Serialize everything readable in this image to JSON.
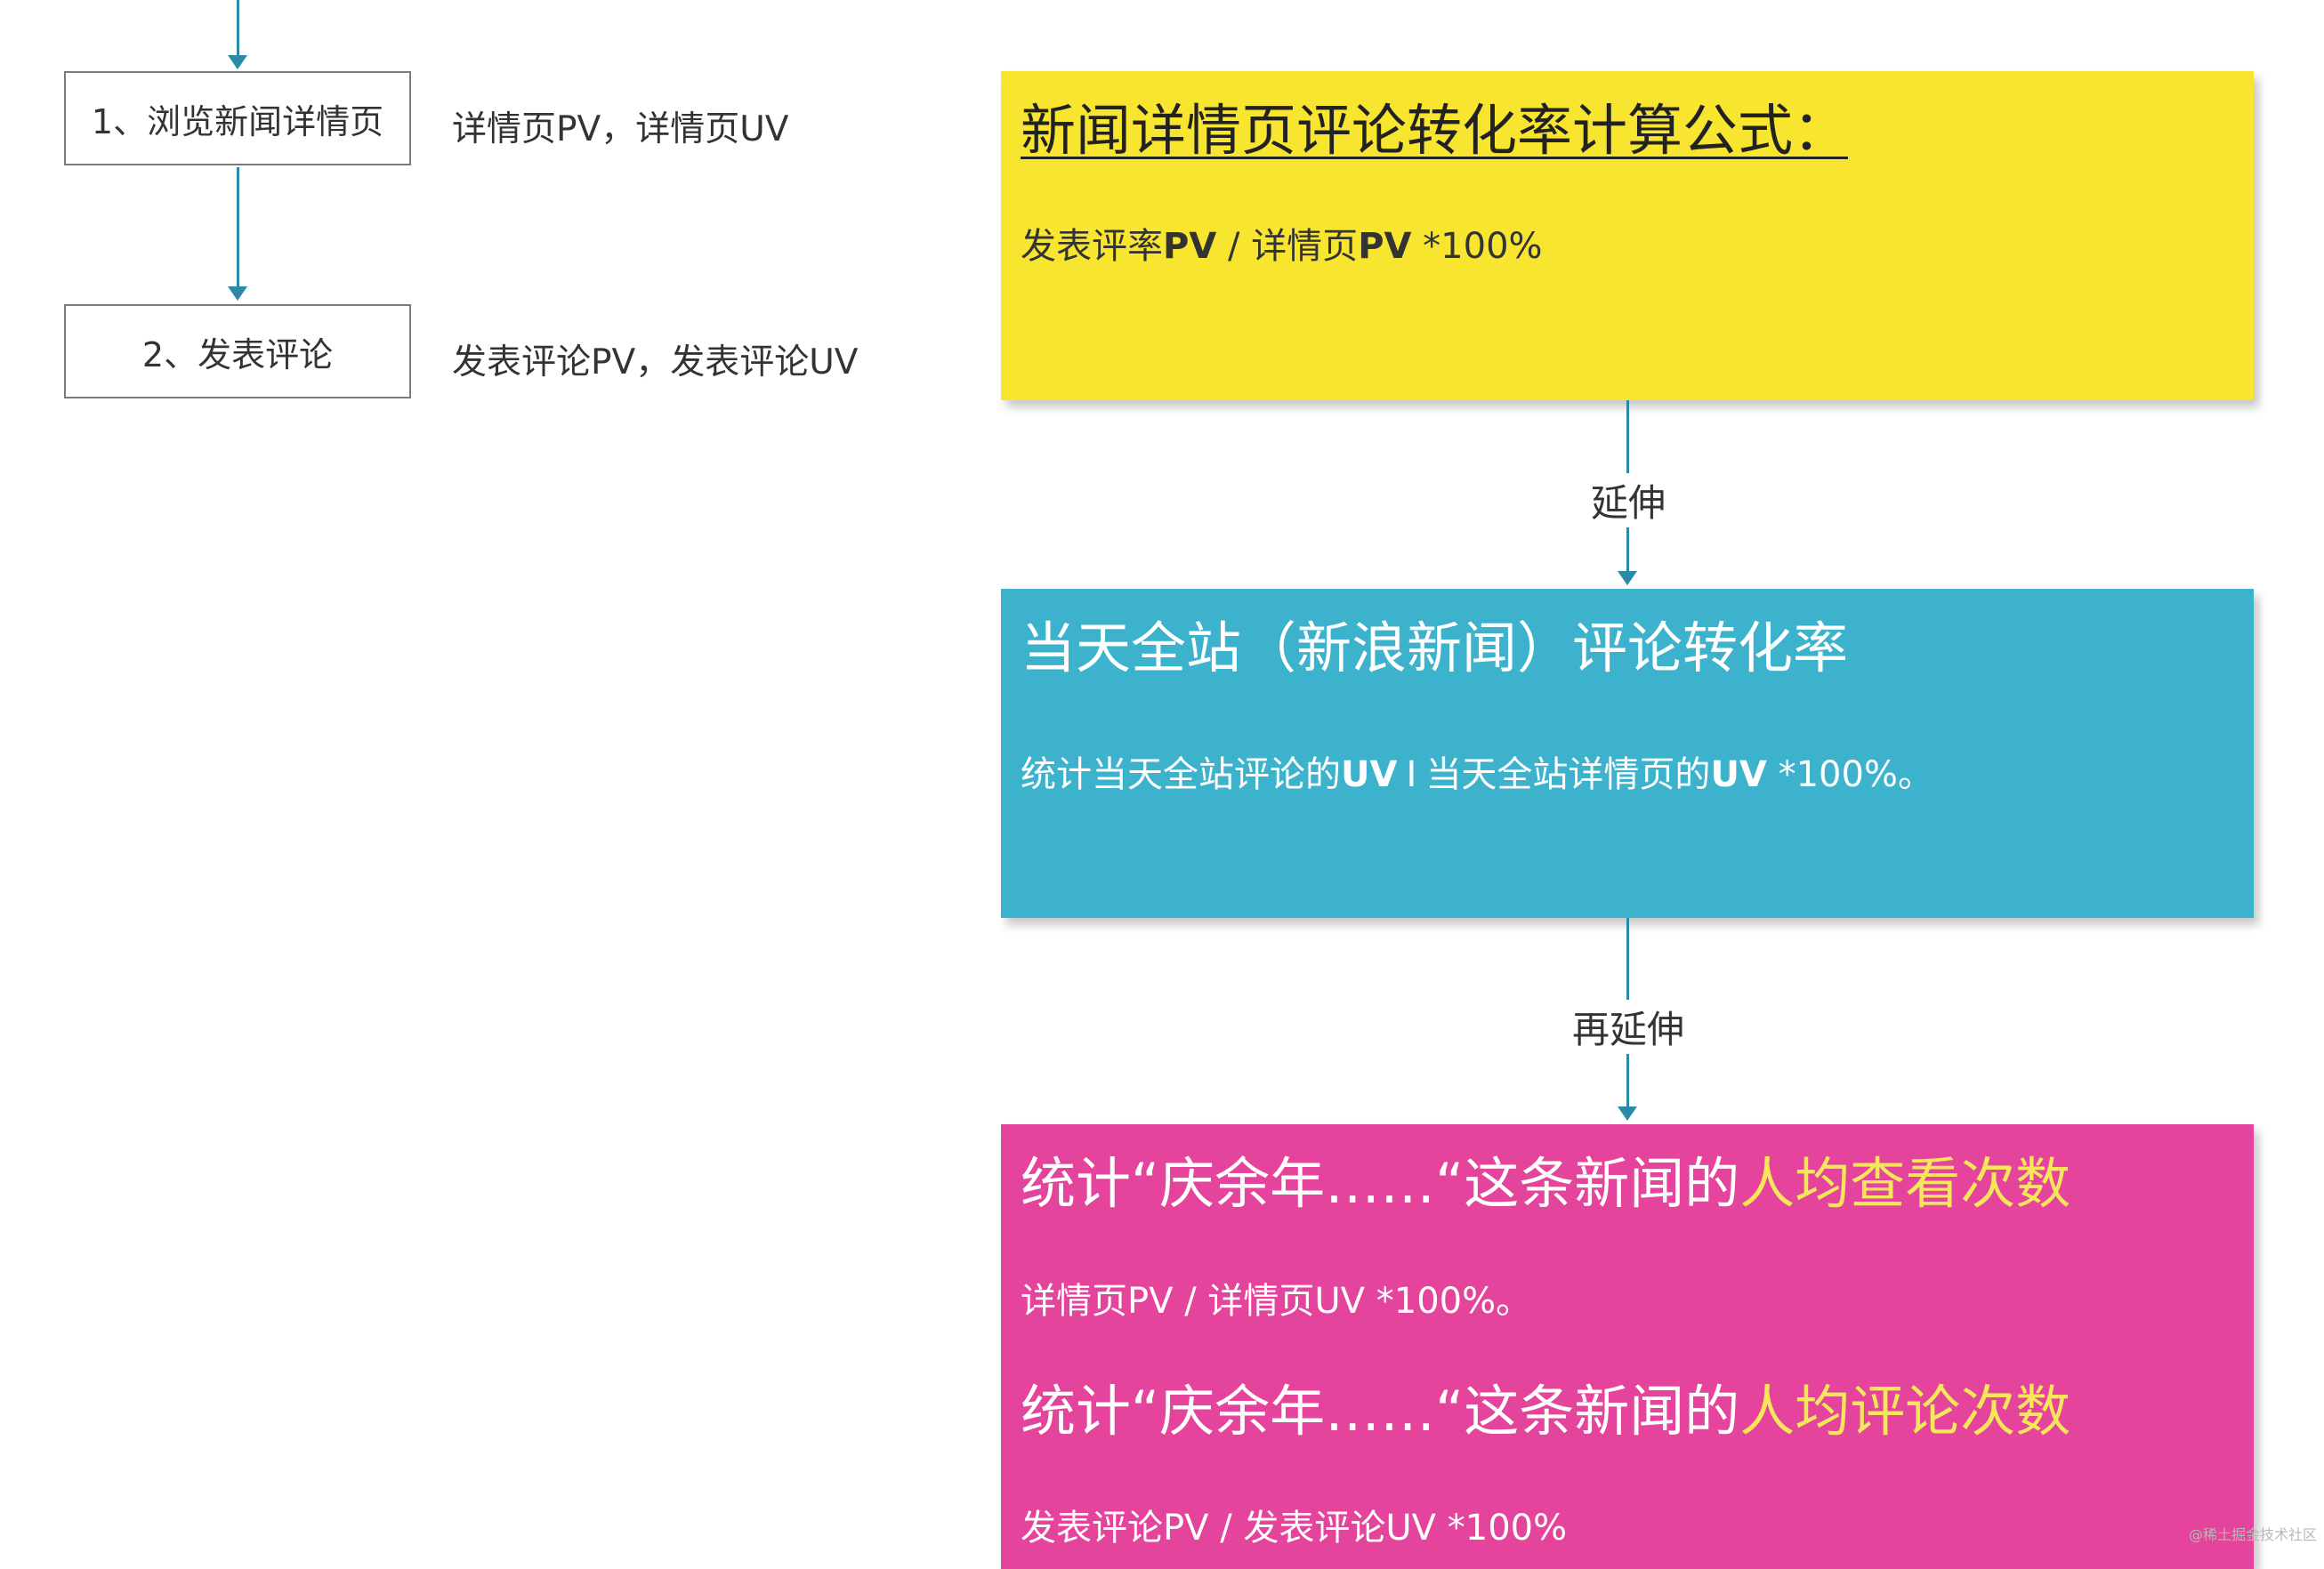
{
  "steps": [
    {
      "label": "1、浏览新闻详情页",
      "metric": "详情页PV，详情页UV"
    },
    {
      "label": "2、发表评论",
      "metric": "发表评论PV，发表评论UV"
    }
  ],
  "cards": {
    "formula": {
      "title": "新闻详情页评论转化率计算公式：",
      "f_a": "发表评率",
      "f_b": "PV",
      "f_c": " / 详情页",
      "f_d": "PV",
      "f_e": " *100%"
    },
    "site": {
      "title": "当天全站（新浪新闻）评论转化率",
      "f_a": "统计当天全站评论的",
      "f_b": "UV",
      "f_c": "当天全站详情页的",
      "f_d": "UV",
      "f_e": " *100%。"
    },
    "news": {
      "title1_a": "统计“庆余年……“这条新闻的",
      "title1_b": "人均查看次数",
      "formula1": "详情页PV / 详情页UV *100%。",
      "title2_a": "统计“庆余年……“这条新闻的",
      "title2_b": "人均评论次数",
      "formula2": "发表评论PV / 发表评论UV *100%"
    }
  },
  "connectors": {
    "first": "延伸",
    "second": "再延伸"
  },
  "watermark": "@稀土掘金技术社区",
  "colors": {
    "yellow": "#f8e52f",
    "blue": "#3db2cc",
    "pink": "#e4449c",
    "highlight": "#f5e65a",
    "line": "#2a8aa8"
  }
}
